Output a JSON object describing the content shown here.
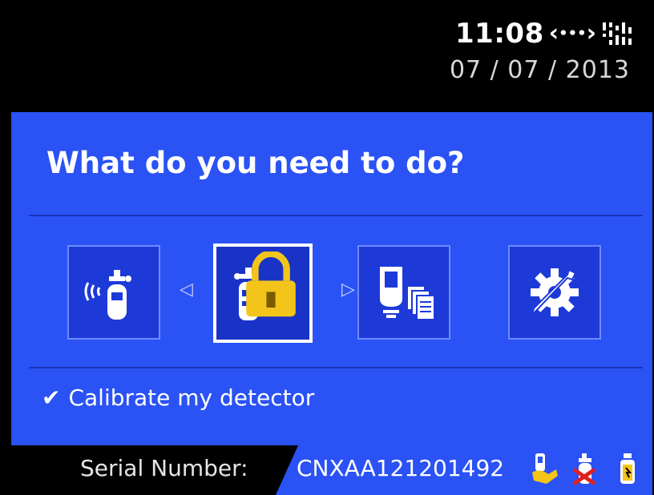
{
  "header": {
    "time": "11:08",
    "connection_icon": "network-connection-icon",
    "signal_icon": "signal-strength-icon",
    "date": "07 / 07 / 2013"
  },
  "main": {
    "heading": "What do you need to do?",
    "options": [
      {
        "id": "bump-test",
        "icon": "wireless-gas-cylinder-icon",
        "selected": false
      },
      {
        "id": "calibrate",
        "icon": "gas-cylinder-calibrate-icon",
        "selected": true,
        "locked": true
      },
      {
        "id": "reports",
        "icon": "detector-reports-icon",
        "selected": false
      },
      {
        "id": "settings",
        "icon": "tools-settings-icon",
        "selected": false
      }
    ],
    "selected_label": "Calibrate my detector"
  },
  "footer": {
    "serial_label": "Serial Number:",
    "serial_value": "CNXAA121201492",
    "status_icons": [
      "hand-detector-icon",
      "cylinder-error-icon",
      "bottle-status-icon"
    ]
  },
  "colors": {
    "panel_blue": "#2a52f5",
    "tile_blue": "#1d3ad8",
    "lock_yellow": "#f3c51a",
    "error_red": "#e02020"
  }
}
